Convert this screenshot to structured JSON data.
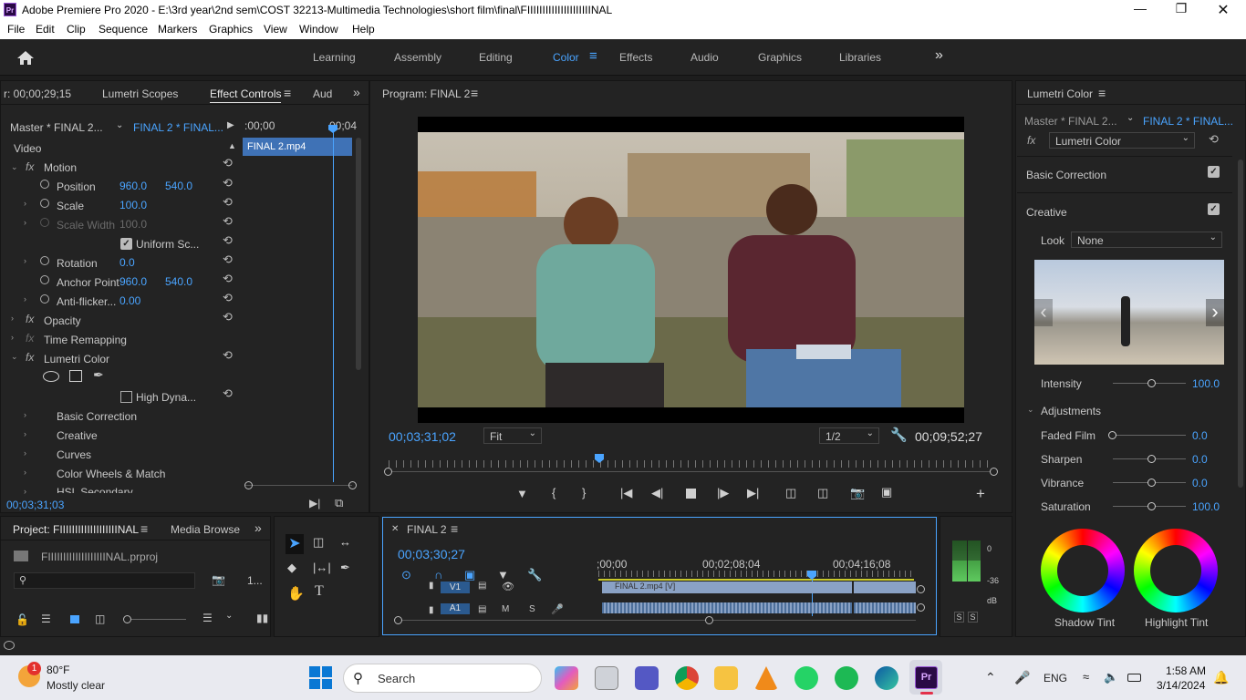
{
  "window": {
    "title": "Adobe Premiere Pro 2020 - E:\\3rd year\\2nd sem\\COST 32213-Multimedia Technologies\\short film\\final\\FIIIIIIIIIIIIIIIIIIIIINAL",
    "app_icon": "Pr"
  },
  "menu": [
    "File",
    "Edit",
    "Clip",
    "Sequence",
    "Markers",
    "Graphics",
    "View",
    "Window",
    "Help"
  ],
  "workspaces": [
    "Learning",
    "Assembly",
    "Editing",
    "Color",
    "Effects",
    "Audio",
    "Graphics",
    "Libraries"
  ],
  "active_workspace": "Color",
  "left_panel": {
    "tabs": [
      "r: 00;00;29;15",
      "Lumetri Scopes",
      "Effect Controls",
      "Aud"
    ],
    "master_label": "Master * FINAL 2...",
    "clip_label": "FINAL 2 * FINAL...",
    "timecode_start": ":00;00",
    "timecode_end": "00;04",
    "clip_name": "FINAL 2.mp4",
    "section": "Video",
    "motion": "Motion",
    "position_label": "Position",
    "position_x": "960.0",
    "position_y": "540.0",
    "scale_label": "Scale",
    "scale_val": "100.0",
    "scale_width_label": "Scale Width",
    "scale_width_val": "100.0",
    "uniform_scale": "Uniform Sc...",
    "rotation_label": "Rotation",
    "rotation_val": "0.0",
    "anchor_label": "Anchor Point",
    "anchor_x": "960.0",
    "anchor_y": "540.0",
    "antiflicker_label": "Anti-flicker...",
    "antiflicker_val": "0.00",
    "opacity": "Opacity",
    "time_remap": "Time Remapping",
    "lumetri": "Lumetri Color",
    "high_dyn": "High Dyna...",
    "sub_items": [
      "Basic Correction",
      "Creative",
      "Curves",
      "Color Wheels & Match",
      "HSL Secondary"
    ],
    "bottom_tc": "00;03;31;03"
  },
  "program": {
    "title": "Program: FINAL 2",
    "current_tc": "00;03;31;02",
    "fit": "Fit",
    "res": "1/2",
    "duration": "00;09;52;27"
  },
  "lumetri_panel": {
    "title": "Lumetri Color",
    "master_label": "Master * FINAL 2...",
    "clip_label": "FINAL 2 * FINAL...",
    "fx_select": "Lumetri Color",
    "basic": "Basic Correction",
    "creative": "Creative",
    "look_label": "Look",
    "look_value": "None",
    "intensity_label": "Intensity",
    "intensity_val": "100.0",
    "adjustments": "Adjustments",
    "faded_label": "Faded Film",
    "faded_val": "0.0",
    "sharpen_label": "Sharpen",
    "sharpen_val": "0.0",
    "vibrance_label": "Vibrance",
    "vibrance_val": "0.0",
    "saturation_label": "Saturation",
    "saturation_val": "100.0",
    "shadow_tint": "Shadow Tint",
    "highlight_tint": "Highlight Tint"
  },
  "project": {
    "tab": "Project: FIIIIIIIIIIIIIIIIIIINAL",
    "tab2": "Media Browse",
    "file": "FIIIIIIIIIIIIIIIIIIINAL.prproj",
    "count": "1..."
  },
  "timeline": {
    "seq": "FINAL 2",
    "tc": "00;03;30;27",
    "ruler": [
      ";00;00",
      "00;02;08;04",
      "00;04;16;08"
    ],
    "v1": "V1",
    "a1": "A1",
    "clip": "FINAL 2.mp4 [V]"
  },
  "meter": [
    "0",
    "-36",
    "dB",
    "S",
    "S"
  ],
  "taskbar": {
    "temp": "80°F",
    "weather": "Mostly clear",
    "search": "Search",
    "lang": "ENG",
    "time": "1:58 AM",
    "date": "3/14/2024",
    "badge": "1"
  }
}
